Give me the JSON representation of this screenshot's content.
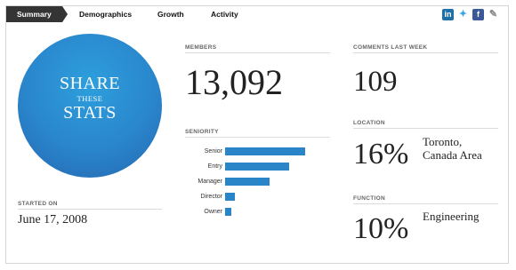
{
  "tabs": [
    {
      "label": "Summary",
      "active": true
    },
    {
      "label": "Demographics",
      "active": false
    },
    {
      "label": "Growth",
      "active": false
    },
    {
      "label": "Activity",
      "active": false
    }
  ],
  "social": [
    "linkedin-icon",
    "twitter-icon",
    "facebook-icon",
    "share-pen-icon"
  ],
  "share_circle": {
    "line1": "SHARE",
    "line2": "THESE",
    "line3": "STATS"
  },
  "started_on": {
    "label": "STARTED ON",
    "value": "June 17, 2008"
  },
  "members": {
    "label": "MEMBERS",
    "value": "13,092"
  },
  "seniority": {
    "label": "SENIORITY"
  },
  "chart_data": {
    "type": "bar",
    "orientation": "horizontal",
    "title": "SENIORITY",
    "categories": [
      "Senior",
      "Entry",
      "Manager",
      "Director",
      "Owner"
    ],
    "values": [
      100,
      80,
      55,
      12,
      8
    ],
    "color": "#2a84c8"
  },
  "comments": {
    "label": "COMMENTS LAST WEEK",
    "value": "109"
  },
  "location": {
    "label": "LOCATION",
    "percent": "16%",
    "line1": "Toronto,",
    "line2": "Canada Area"
  },
  "function": {
    "label": "FUNCTION",
    "percent": "10%",
    "name": "Engineering"
  }
}
